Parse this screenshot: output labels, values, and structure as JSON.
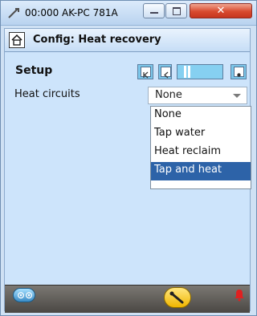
{
  "window": {
    "title": "00:000 AK-PC 781A"
  },
  "page": {
    "title": "Config: Heat recovery"
  },
  "setup": {
    "label": "Setup"
  },
  "heat": {
    "label": "Heat circuits",
    "value": "None",
    "options": [
      "None",
      "Tap water",
      "Heat reclaim",
      "Tap and heat"
    ],
    "selected": "Tap and heat"
  },
  "colors": {
    "accent": "#2d63a8",
    "nav": "#7cc7ea",
    "close": "#d84a2f",
    "alarm": "#e02020",
    "key": "#f0b600"
  }
}
